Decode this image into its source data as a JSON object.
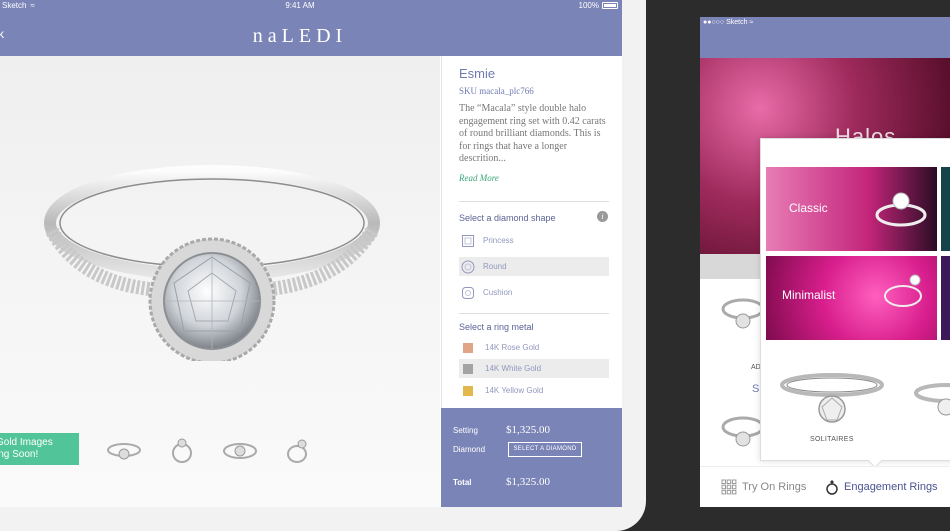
{
  "ipad": {
    "status": {
      "carrier": "Sketch",
      "time": "9:41 AM",
      "battery": "100%"
    },
    "nav": {
      "back_label": "ck",
      "brand": "naLEDI"
    },
    "gold_banner": {
      "line1": "Gold Images",
      "line2": "ing Soon!"
    },
    "thumbnails": [
      "ring-side-view",
      "ring-front-view",
      "ring-band-view",
      "ring-angle-view"
    ],
    "product": {
      "name": "Esmie",
      "sku": "SKU  macala_plc766",
      "description": "The “Macala” style double halo engagement ring set with 0.42 carats of round brilliant diamonds. This is for rings that have a longer descrition...",
      "read_more": "Read More"
    },
    "diamond_shape": {
      "title": "Select a diamond shape",
      "options": [
        {
          "label": "Princess",
          "selected": false
        },
        {
          "label": "Round",
          "selected": true
        },
        {
          "label": "Cushion",
          "selected": false
        }
      ]
    },
    "ring_metal": {
      "title": "Select a ring metal",
      "options": [
        {
          "label": "14K Rose Gold",
          "color": "#e0a487",
          "selected": false
        },
        {
          "label": "14K White Gold",
          "color": "#a3a3a3",
          "selected": true
        },
        {
          "label": "14K Yellow Gold",
          "color": "#e2b84c",
          "selected": false
        }
      ]
    },
    "pricing": {
      "setting_label": "Setting",
      "setting_value": "$1,325.00",
      "diamond_label": "Diamond",
      "select_diamond": "SELECT A DIAMOND",
      "total_label": "Total",
      "total_value": "$1,325.00"
    }
  },
  "iphone": {
    "status": {
      "carrier": "Sketch"
    },
    "hero_title": "Halos",
    "list_caption_partial": "AD",
    "list_letter_partial": "S",
    "popup": {
      "tiles": [
        {
          "label": "Classic"
        },
        {
          "label": "Minimalist"
        }
      ],
      "solitaires_label": "SOLITAIRES"
    },
    "tabs": [
      {
        "label": "Try On Rings",
        "icon": "grid-icon",
        "active": false
      },
      {
        "label": "Engagement Rings",
        "icon": "ring-icon",
        "active": true
      }
    ]
  },
  "colors": {
    "accent": "#7a84b6",
    "green": "#52c49a",
    "link": "#3aa579"
  }
}
